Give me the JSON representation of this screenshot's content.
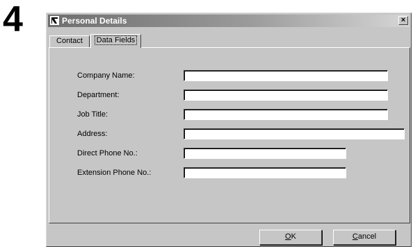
{
  "step": "4",
  "dialog": {
    "title": "Personal Details",
    "close_glyph": "×"
  },
  "tabs": [
    {
      "label": "Contact",
      "active": false
    },
    {
      "label": "Data Fields",
      "active": true
    }
  ],
  "fields": [
    {
      "label": "Company Name:",
      "value": ""
    },
    {
      "label": "Department:",
      "value": ""
    },
    {
      "label": "Job Title:",
      "value": ""
    },
    {
      "label": "Address:",
      "value": ""
    },
    {
      "label": "Direct Phone No.:",
      "value": ""
    },
    {
      "label": "Extension Phone No.:",
      "value": ""
    }
  ],
  "buttons": {
    "ok": {
      "mnemonic": "O",
      "rest": "K"
    },
    "cancel": {
      "mnemonic": "C",
      "rest": "ancel"
    }
  },
  "icons": {
    "title_icon": "app-icon",
    "close_icon": "close-icon"
  }
}
